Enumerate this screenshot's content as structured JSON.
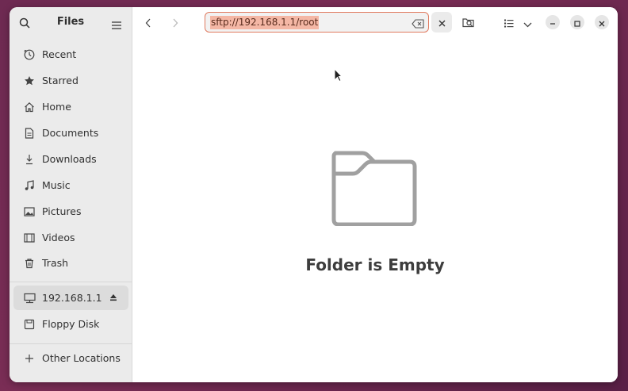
{
  "sidebar": {
    "title": "Files",
    "items": [
      {
        "label": "Recent",
        "icon": "clock-icon"
      },
      {
        "label": "Starred",
        "icon": "star-icon"
      },
      {
        "label": "Home",
        "icon": "home-icon"
      },
      {
        "label": "Documents",
        "icon": "document-icon"
      },
      {
        "label": "Downloads",
        "icon": "download-icon"
      },
      {
        "label": "Music",
        "icon": "music-icon"
      },
      {
        "label": "Pictures",
        "icon": "picture-icon"
      },
      {
        "label": "Videos",
        "icon": "video-icon"
      },
      {
        "label": "Trash",
        "icon": "trash-icon"
      }
    ],
    "mounts": [
      {
        "label": "192.168.1.1",
        "icon": "network-drive-icon",
        "active": true
      },
      {
        "label": "Floppy Disk",
        "icon": "floppy-icon"
      }
    ],
    "other_locations": "Other Locations"
  },
  "header": {
    "location": "sftp://192.168.1.1/root"
  },
  "main": {
    "empty_label": "Folder is Empty"
  },
  "colors": {
    "accent": "#e07a5f",
    "selection": "#f4b7a5",
    "sidebar_bg": "#ebebeb"
  }
}
